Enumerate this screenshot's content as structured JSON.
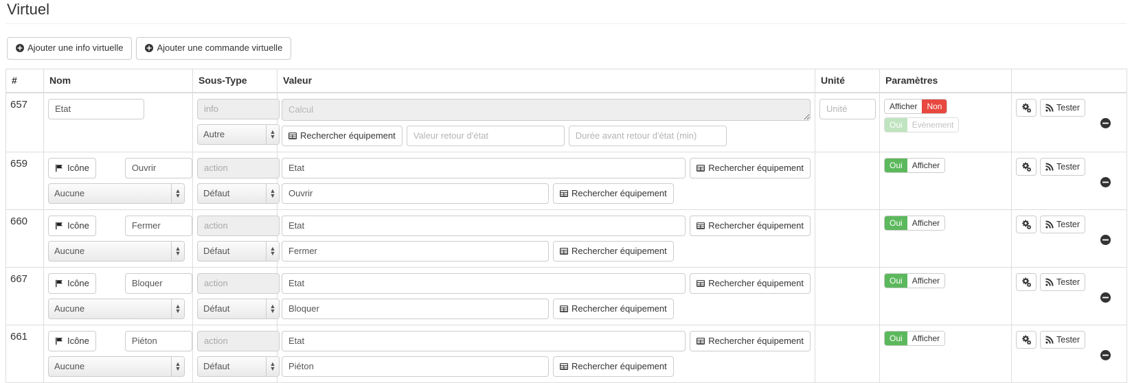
{
  "page": {
    "title": "Virtuel"
  },
  "toolbar": {
    "add_info_label": "Ajouter une info virtuelle",
    "add_command_label": "Ajouter une commande virtuelle",
    "plus_icon": "plus-circle-icon"
  },
  "table": {
    "headers": [
      "#",
      "Nom",
      "Sous-Type",
      "Valeur",
      "Unité",
      "Paramètres",
      ""
    ],
    "common": {
      "search_equipment_label": "Rechercher équipement",
      "icon_button_label": "Icône",
      "test_button_label": "Tester",
      "config_icon": "gears-icon",
      "test_icon": "rss-icon",
      "remove_icon": "minus-circle-icon",
      "flag_icon": "flag-icon",
      "table_icon": "table-icon"
    },
    "rows": [
      {
        "id": "657",
        "kind": "info",
        "name_value": "Etat",
        "subtype_placeholder": "info",
        "subtype_select_value": "Autre",
        "calc_placeholder": "Calcul",
        "return_value_placeholder": "Valeur retour d'état",
        "return_delay_placeholder": "Durée avant retour d'état (min)",
        "unite_placeholder": "Unité",
        "params": [
          {
            "off_label": "Afficher",
            "on_label": "Non",
            "state": "non",
            "disabled": false
          },
          {
            "off_label": "Evènement",
            "on_label": "Oui",
            "state": "oui",
            "disabled": true
          }
        ]
      },
      {
        "id": "659",
        "kind": "action",
        "name_value": "Ouvrir",
        "name_icon_label": "Icône",
        "name_select_value": "Aucune",
        "subtype_placeholder": "action",
        "subtype_select_value": "Défaut",
        "value_state": "Etat",
        "value_action": "Ouvrir",
        "params": [
          {
            "off_label": "Afficher",
            "on_label": "Oui",
            "state": "oui",
            "disabled": false
          }
        ]
      },
      {
        "id": "660",
        "kind": "action",
        "name_value": "Fermer",
        "name_icon_label": "Icône",
        "name_select_value": "Aucune",
        "subtype_placeholder": "action",
        "subtype_select_value": "Défaut",
        "value_state": "Etat",
        "value_action": "Fermer",
        "params": [
          {
            "off_label": "Afficher",
            "on_label": "Oui",
            "state": "oui",
            "disabled": false
          }
        ]
      },
      {
        "id": "667",
        "kind": "action",
        "name_value": "Bloquer",
        "name_icon_label": "Icône",
        "name_select_value": "Aucune",
        "subtype_placeholder": "action",
        "subtype_select_value": "Défaut",
        "value_state": "Etat",
        "value_action": "Bloquer",
        "params": [
          {
            "off_label": "Afficher",
            "on_label": "Oui",
            "state": "oui",
            "disabled": false
          }
        ]
      },
      {
        "id": "661",
        "kind": "action",
        "name_value": "Piéton",
        "name_icon_label": "Icône",
        "name_select_value": "Aucune",
        "subtype_placeholder": "action",
        "subtype_select_value": "Défaut",
        "value_state": "Etat",
        "value_action": "Piéton",
        "params": [
          {
            "off_label": "Afficher",
            "on_label": "Oui",
            "state": "oui",
            "disabled": false
          }
        ]
      }
    ]
  },
  "colors": {
    "success": "#5cb85c",
    "danger": "#e8483f",
    "border": "#cccccc",
    "table_border": "#dddddd"
  }
}
